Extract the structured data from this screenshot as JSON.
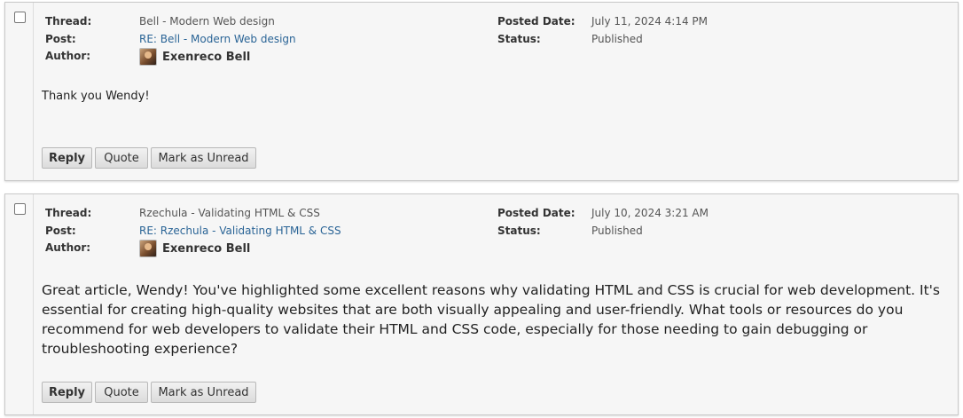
{
  "labels": {
    "thread": "Thread:",
    "post": "Post:",
    "author": "Author:",
    "posted_date": "Posted Date:",
    "status": "Status:"
  },
  "posts": [
    {
      "thread": "Bell - Modern Web design",
      "post_link": "RE: Bell - Modern Web design",
      "author": "Exenreco Bell",
      "posted_date": "July 11, 2024 4:14 PM",
      "status": "Published",
      "body": "Thank you Wendy!",
      "buttons": {
        "reply": "Reply",
        "quote": "Quote",
        "mark_unread": "Mark as Unread"
      }
    },
    {
      "thread": "Rzechula - Validating HTML & CSS",
      "post_link": "RE: Rzechula - Validating HTML & CSS",
      "author": "Exenreco Bell",
      "posted_date": "July 10, 2024 3:21 AM",
      "status": "Published",
      "body": "Great article, Wendy! You've highlighted some excellent reasons why validating HTML and CSS is crucial for web development. It's essential for creating high-quality websites that are both visually appealing and user-friendly. What tools or resources do you recommend for web developers to validate their HTML and CSS code, especially for those needing to gain debugging or troubleshooting experience?",
      "buttons": {
        "reply": "Reply",
        "quote": "Quote",
        "mark_unread": "Mark as Unread"
      }
    }
  ]
}
